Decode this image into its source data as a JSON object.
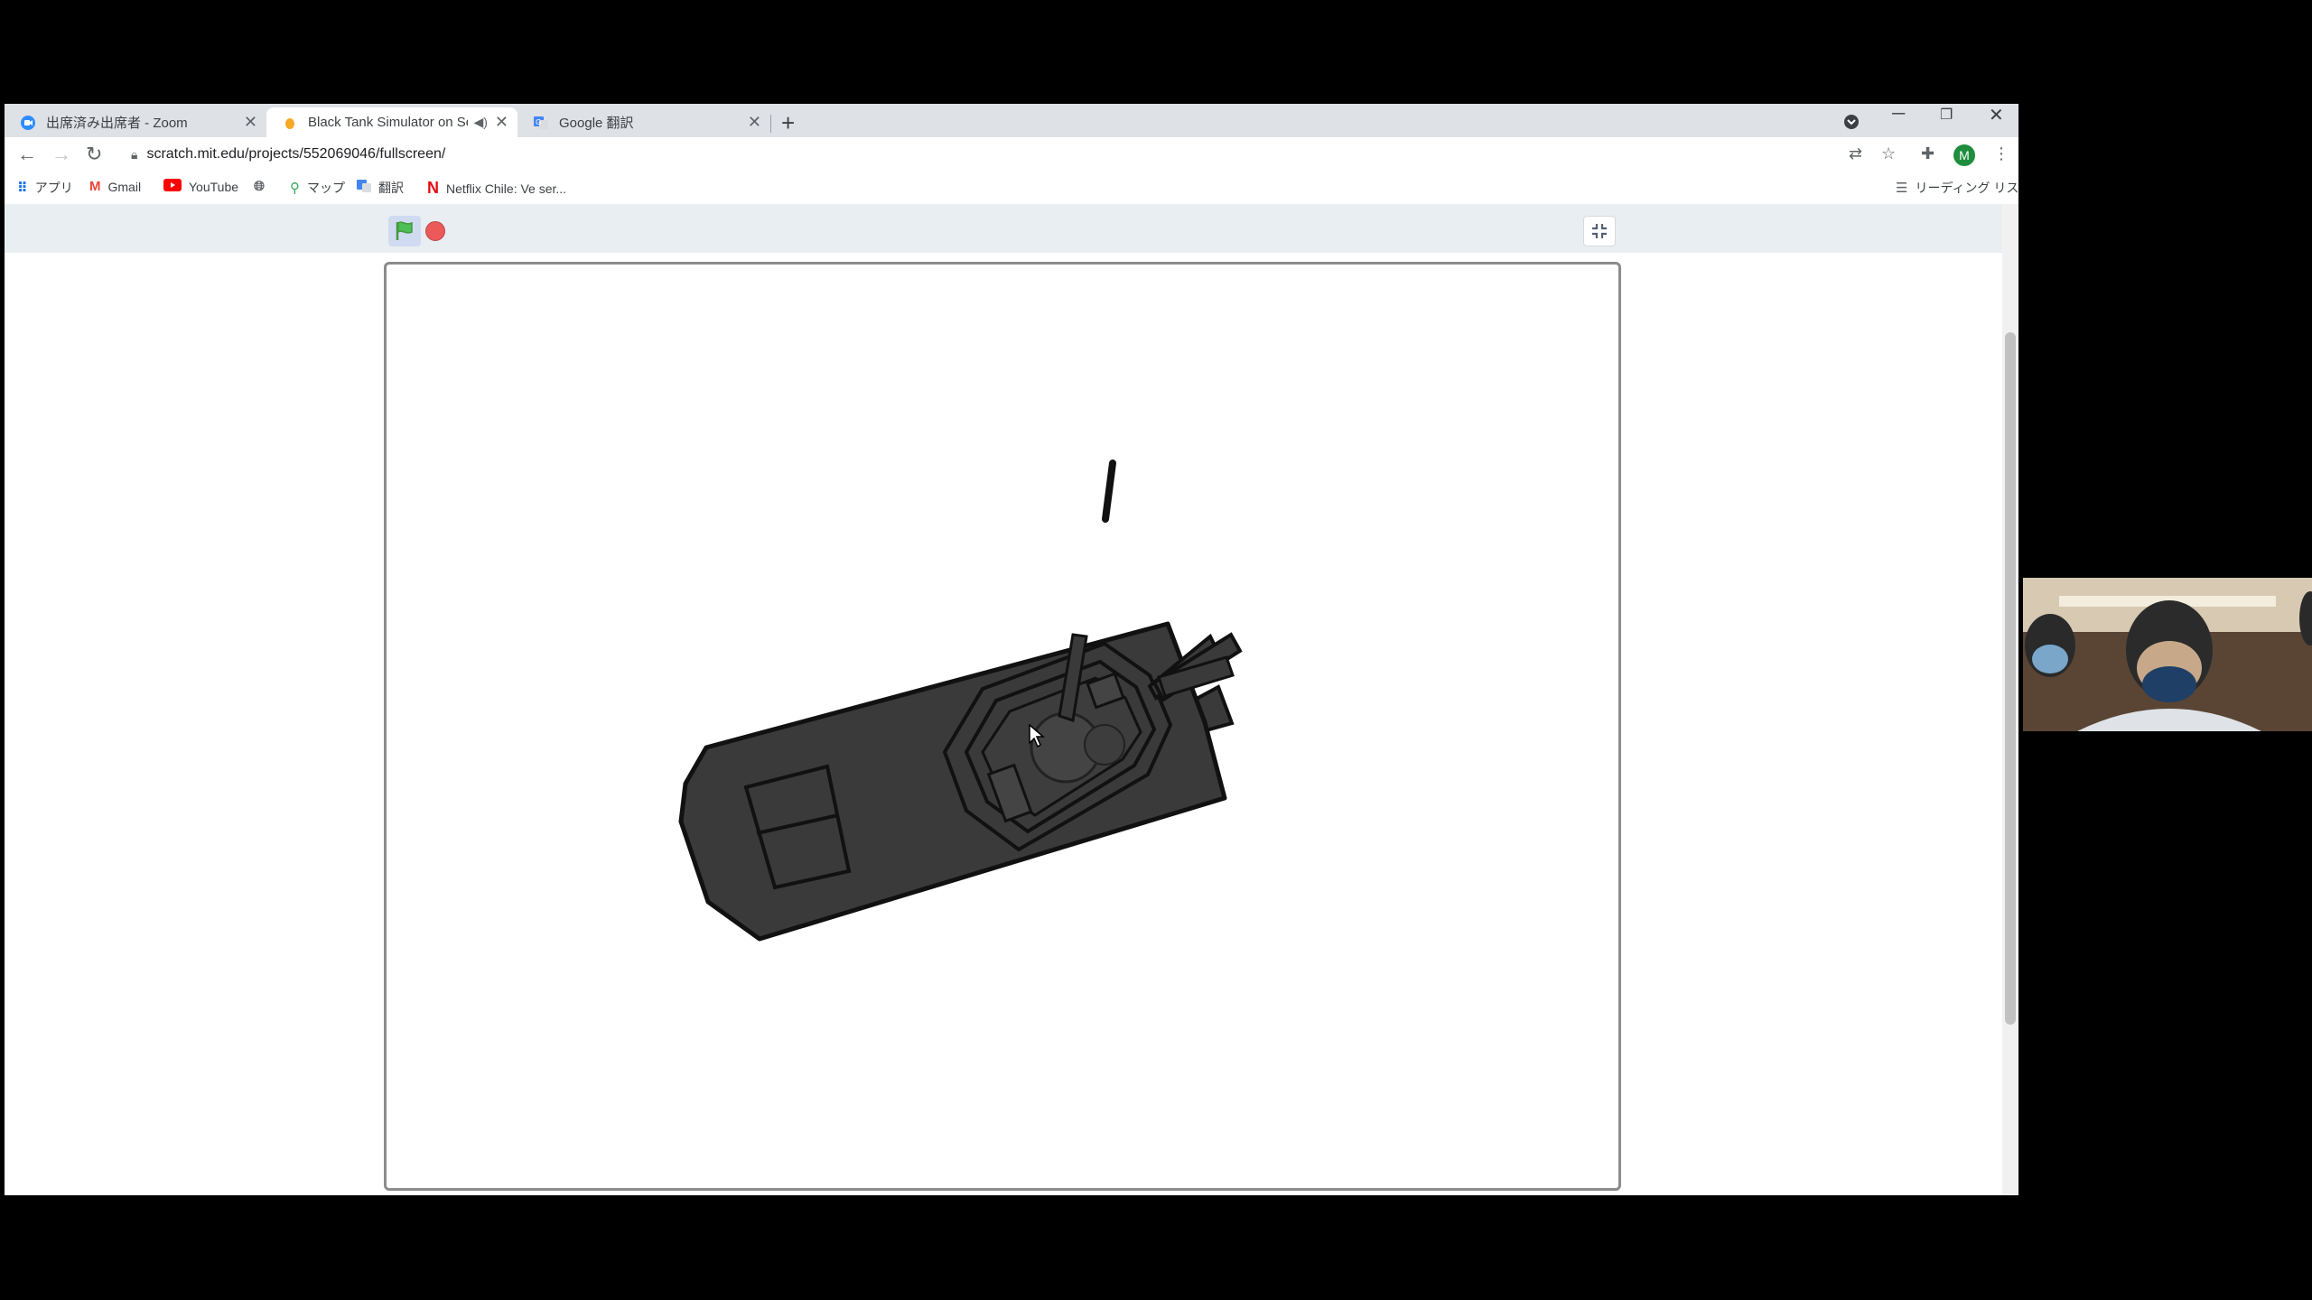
{
  "tabs": [
    {
      "title": "出席済み出席者 - Zoom",
      "active": false
    },
    {
      "title": "Black Tank Simulator on Scra",
      "active": true,
      "audio": true
    },
    {
      "title": "Google 翻訳",
      "active": false
    }
  ],
  "toolbar": {
    "url": "scratch.mit.edu/projects/552069046/fullscreen/",
    "profile_initial": "M"
  },
  "bookmarks": {
    "items": [
      {
        "label": "アプリ",
        "icon": "apps-grid-icon"
      },
      {
        "label": "Gmail",
        "icon": "gmail-icon"
      },
      {
        "label": "YouTube",
        "icon": "youtube-icon"
      },
      {
        "label": "",
        "icon": "globe-icon"
      },
      {
        "label": "マップ",
        "icon": "maps-icon"
      },
      {
        "label": "翻訳",
        "icon": "translate-icon"
      },
      {
        "label": "Netflix Chile: Ve ser...",
        "icon": "netflix-icon"
      }
    ],
    "reading_list": "リーディング リスト"
  },
  "scratch": {
    "green_flag": "green-flag-icon",
    "stop": "stop-icon",
    "fullscreen_toggle": "exit-fullscreen-icon"
  },
  "colors": {
    "tank_fill": "#3a3a3a",
    "tank_outline": "#111111",
    "stage_border": "#8c8c8c",
    "flag_green": "#4cbf56",
    "stop_red": "#ec5959"
  }
}
